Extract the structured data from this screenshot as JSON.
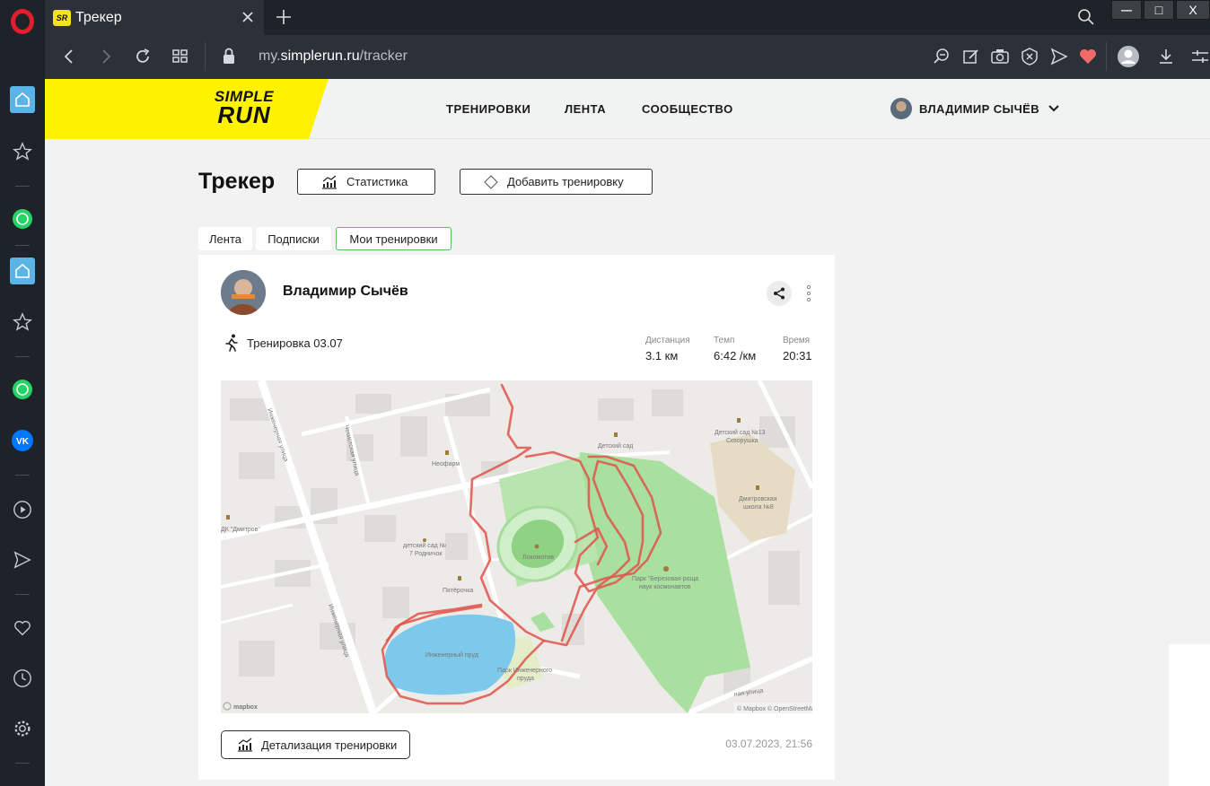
{
  "browser": {
    "tab_title": "Трекер",
    "favicon_text": "SR",
    "url_prefix": "my.",
    "url_domain": "simplerun.ru",
    "url_path": "/tracker",
    "win_min": "—",
    "win_max": "□",
    "win_close": "X"
  },
  "site": {
    "logo_line1": "SIMPLE",
    "logo_line2": "RUN",
    "nav": [
      "ТРЕНИРОВКИ",
      "ЛЕНТА",
      "СООБЩЕСТВО"
    ],
    "user_name": "ВЛАДИМИР СЫЧЁВ",
    "brand_yellow": "#fff200"
  },
  "page": {
    "title": "Трекер",
    "stats_button": "Статистика",
    "add_button": "Добавить тренировку",
    "tabs": [
      "Лента",
      "Подписки",
      "Мои тренировки"
    ],
    "active_tab": "Мои тренировки"
  },
  "workout": {
    "author": "Владимир Сычёв",
    "name": "Тренировка 03.07",
    "distance_label": "Дистанция",
    "distance_value": "3.1 км",
    "pace_label": "Темп",
    "pace_value": "6:42 /км",
    "time_label": "Время",
    "time_value": "20:31",
    "details_button": "Детализация тренировки",
    "date": "03.07.2023, 21:56",
    "route_color": "#e0534a"
  },
  "map": {
    "labels": {
      "street1": "Инженерная улица",
      "street2": "Инженерная улица",
      "street3": "Чекистская улица",
      "street4": "ная улица",
      "neofarm": "Неофарм",
      "dk_dmitrov": "ДК \"Дмитров\"",
      "kindergarten7_1": "детский сад №",
      "kindergarten7_2": "7 Родничок",
      "pyaterochka": "Пятёрочка",
      "lokomotiv": "Локомотив",
      "kindergarten": "Детский сад",
      "kindergarten13_1": "Детский сад №13",
      "kindergarten13_2": "Скворушка",
      "school8_1": "Дмитровская",
      "school8_2": "школа №8",
      "park_1": "Парк \"Березовая роща",
      "park_2": "наук космонавтов",
      "pond": "Инженерный пруд",
      "pond_park_1": "Парк Инженерного",
      "pond_park_2": "пруда",
      "mapbox": "mapbox",
      "attribution": "© Mapbox © OpenStreetMap"
    }
  }
}
